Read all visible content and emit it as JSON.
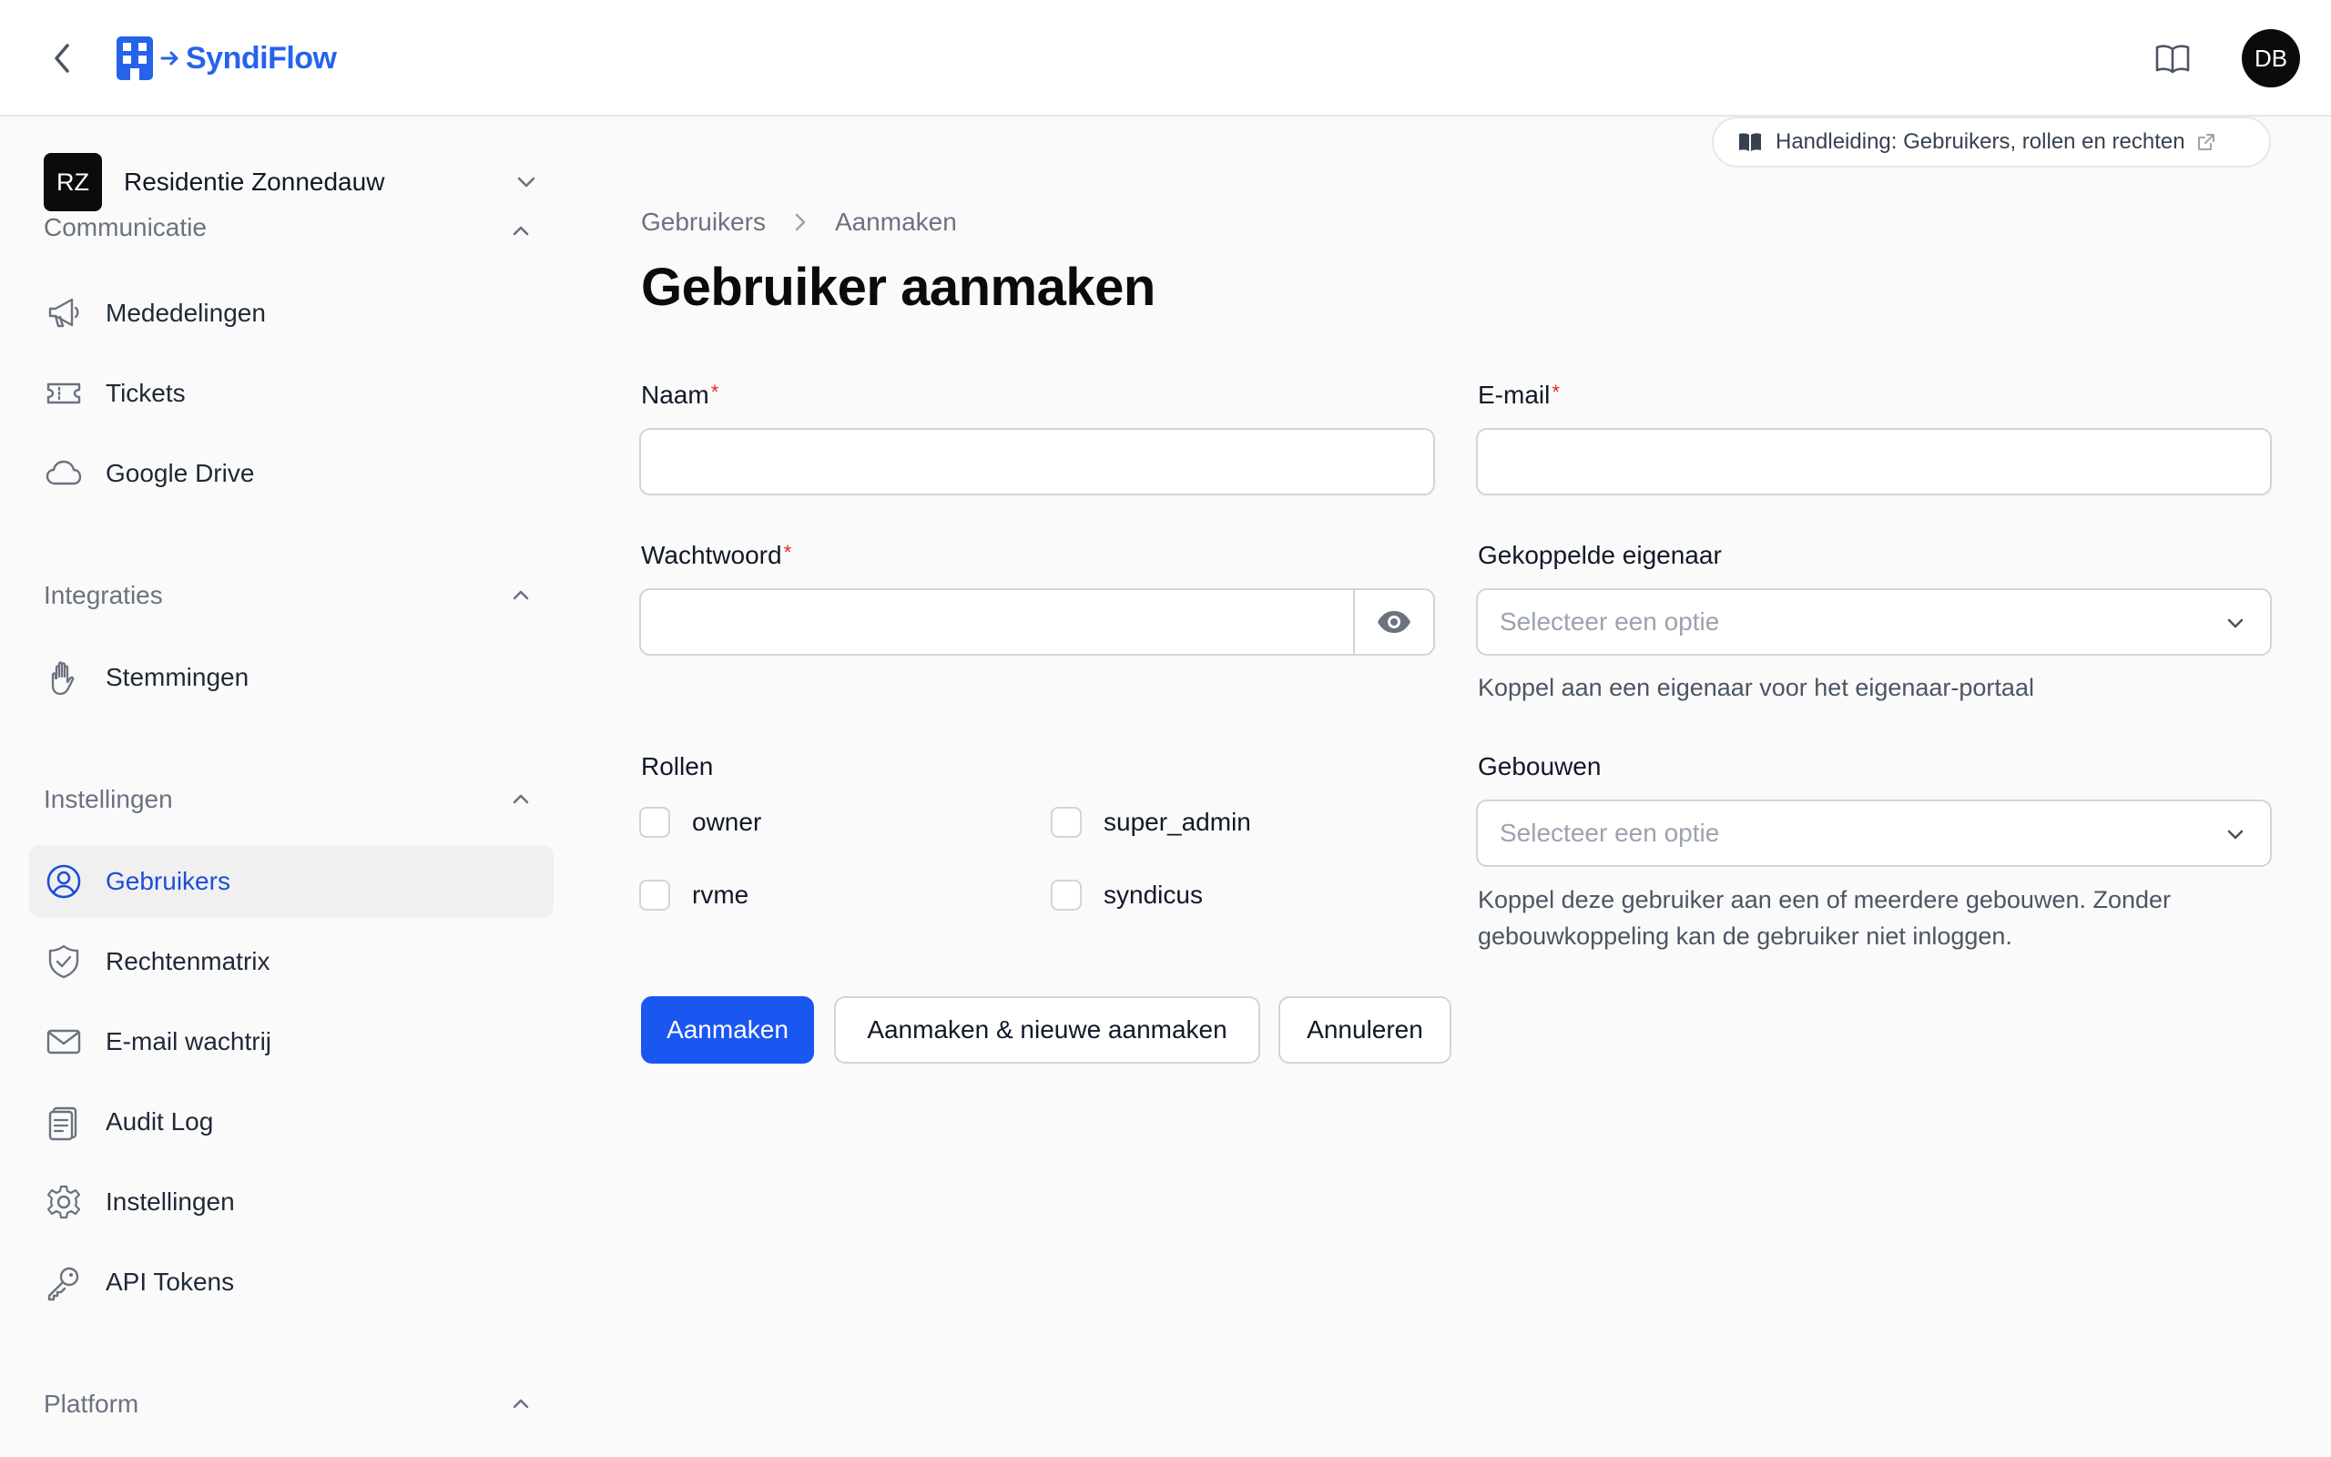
{
  "app": {
    "name": "SyndiFlow",
    "avatar_initials": "DB"
  },
  "tenant": {
    "initials": "RZ",
    "name": "Residentie Zonnedauw"
  },
  "sidebar": {
    "groups": [
      {
        "title": "Communicatie",
        "items": [
          {
            "label": "Mededelingen",
            "icon": "megaphone-icon"
          },
          {
            "label": "Tickets",
            "icon": "ticket-icon"
          },
          {
            "label": "Google Drive",
            "icon": "cloud-icon"
          }
        ]
      },
      {
        "title": "Integraties",
        "items": [
          {
            "label": "Stemmingen",
            "icon": "hand-icon"
          }
        ]
      },
      {
        "title": "Instellingen",
        "items": [
          {
            "label": "Gebruikers",
            "icon": "user-circle-icon",
            "active": true
          },
          {
            "label": "Rechtenmatrix",
            "icon": "shield-check-icon"
          },
          {
            "label": "E-mail wachtrij",
            "icon": "envelope-icon"
          },
          {
            "label": "Audit Log",
            "icon": "clipboard-icon"
          },
          {
            "label": "Instellingen",
            "icon": "gear-icon"
          },
          {
            "label": "API Tokens",
            "icon": "key-icon"
          }
        ]
      },
      {
        "title": "Platform",
        "items": []
      }
    ]
  },
  "manual_link": {
    "label": "Handleiding: Gebruikers, rollen en rechten"
  },
  "breadcrumb": {
    "parent": "Gebruikers",
    "current": "Aanmaken"
  },
  "page": {
    "title": "Gebruiker aanmaken"
  },
  "form": {
    "name": {
      "label": "Naam",
      "required_mark": "*",
      "value": ""
    },
    "email": {
      "label": "E-mail",
      "required_mark": "*",
      "value": ""
    },
    "password": {
      "label": "Wachtwoord",
      "required_mark": "*",
      "value": ""
    },
    "owner": {
      "label": "Gekoppelde eigenaar",
      "placeholder": "Selecteer een optie",
      "help": "Koppel aan een eigenaar voor het eigenaar-portaal"
    },
    "roles": {
      "label": "Rollen",
      "options": [
        "owner",
        "super_admin",
        "rvme",
        "syndicus"
      ]
    },
    "buildings": {
      "label": "Gebouwen",
      "placeholder": "Selecteer een optie",
      "help": "Koppel deze gebruiker aan een of meerdere gebouwen. Zonder gebouwkoppeling kan de gebruiker niet inloggen."
    }
  },
  "actions": {
    "create": "Aanmaken",
    "create_another": "Aanmaken & nieuwe aanmaken",
    "cancel": "Annuleren"
  },
  "colors": {
    "primary": "#1a56f0",
    "brand": "#2563eb",
    "required": "#dc2626"
  }
}
